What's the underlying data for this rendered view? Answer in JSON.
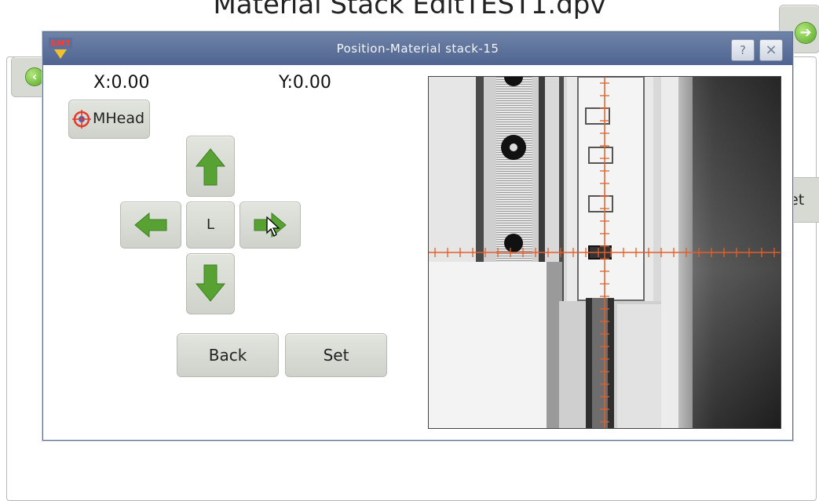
{
  "background": {
    "title": "Material Stack EditTEST1.dpv",
    "right_button_label": "et"
  },
  "dialog": {
    "title": "Position-Material stack-15",
    "logo_text": "SMT",
    "help_label": "?",
    "close_label": "×",
    "x_readout": "X:0.00",
    "y_readout": "Y:0.00",
    "mhead_label": "MHead",
    "center_label": "L",
    "back_label": "Back",
    "set_label": "Set"
  },
  "icons": {
    "up": "arrow-up-icon",
    "down": "arrow-down-icon",
    "left": "arrow-left-icon",
    "right": "arrow-right-icon",
    "target": "crosshair-target-icon",
    "cursor": "mouse-cursor-icon"
  },
  "colors": {
    "title_bar": "#5a6e97",
    "arrow_green": "#5aa332",
    "button_gray": "#d7d9d3",
    "crosshair": "#e0602a"
  }
}
